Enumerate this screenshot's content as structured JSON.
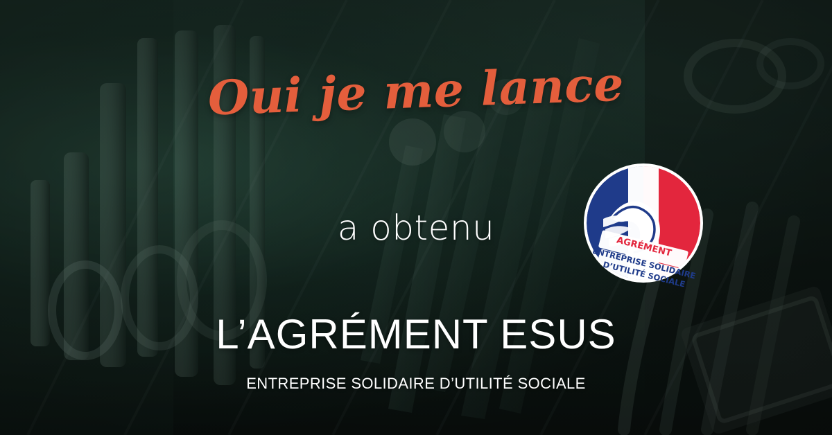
{
  "headline": "Oui je me lance",
  "subhead": "a obtenu",
  "title": "L’AGRÉMENT ESUS",
  "caption": "ENTREPRISE SOLIDAIRE D’UTILITÉ SOCIALE",
  "badge": {
    "label": "AGRÉMENT",
    "line1": "ENTREPRISE SOLIDAIRE",
    "line2": "D’UTILITÉ SOCIALE",
    "icon": "marianne-agrement-badge-icon"
  },
  "colors": {
    "accent": "#e45e3c",
    "text": "#ffffff",
    "badge_blue": "#1f3b8a",
    "badge_red": "#e3263d",
    "background_teal": "#2b4a40"
  }
}
